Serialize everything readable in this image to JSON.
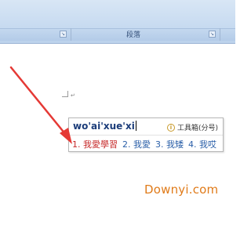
{
  "ribbon": {
    "group_label": "段落"
  },
  "ime": {
    "composition": "wo'ai'xue'xi",
    "toolbox_label": "工具箱(分号)",
    "candidates": [
      "1. 我愛學習",
      "2. 我愛",
      "3. 我矮",
      "4. 我哎"
    ]
  },
  "watermark": "Downyi.com",
  "colors": {
    "arrow": "#e53935",
    "selected_candidate": "#c62828",
    "candidate": "#2a5fa8",
    "watermark": "#e07b1a"
  },
  "icons": {
    "dialog_launcher": "dialog-launcher-icon",
    "toolbox": "toolbox-info-icon",
    "arrow": "pointer-arrow"
  }
}
